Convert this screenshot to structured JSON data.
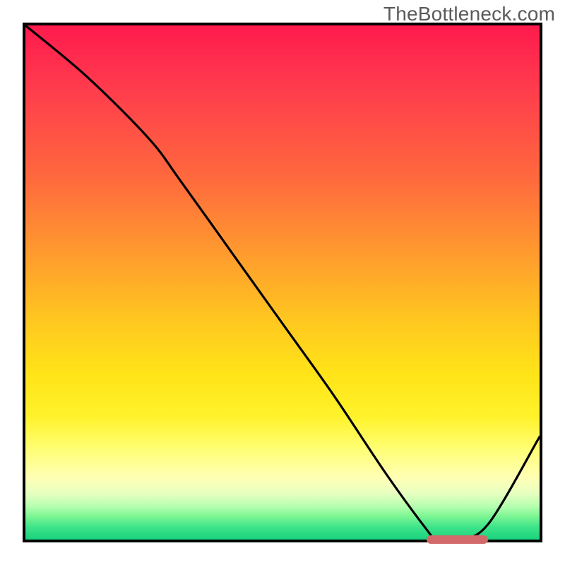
{
  "watermark": "TheBottleneck.com",
  "colors": {
    "border": "#000000",
    "curve": "#000000",
    "marker": "#d36a6a",
    "gradient_top": "#ff1a4d",
    "gradient_bottom": "#18d37d"
  },
  "chart_data": {
    "type": "line",
    "title": "",
    "xlabel": "",
    "ylabel": "",
    "xlim": [
      0,
      100
    ],
    "ylim": [
      0,
      100
    ],
    "grid": false,
    "legend": false,
    "x": [
      0,
      12,
      24,
      30,
      40,
      50,
      60,
      70,
      78,
      80,
      84,
      90,
      100
    ],
    "values": [
      100,
      90,
      78,
      70,
      56,
      42,
      28,
      13,
      2,
      0,
      0,
      3,
      20
    ],
    "notes": "Values are read as normalized 0-100 percentages of the inner plot box; y=0 is the bottom edge, y=100 the top edge. Curve visually estimated from gridless figure.",
    "background_gradient": {
      "direction": "top_to_bottom",
      "semantics": "red (top) = bad, green (bottom) = good",
      "stops": [
        {
          "pos": 0.0,
          "color": "#ff1a4d"
        },
        {
          "pos": 0.45,
          "color": "#ff9d2d"
        },
        {
          "pos": 0.76,
          "color": "#fff22a"
        },
        {
          "pos": 0.95,
          "color": "#7cf593"
        },
        {
          "pos": 1.0,
          "color": "#18d37d"
        }
      ]
    },
    "baseline_marker": {
      "x_start": 78,
      "x_end": 90,
      "y": 0,
      "color": "#d36a6a"
    }
  }
}
